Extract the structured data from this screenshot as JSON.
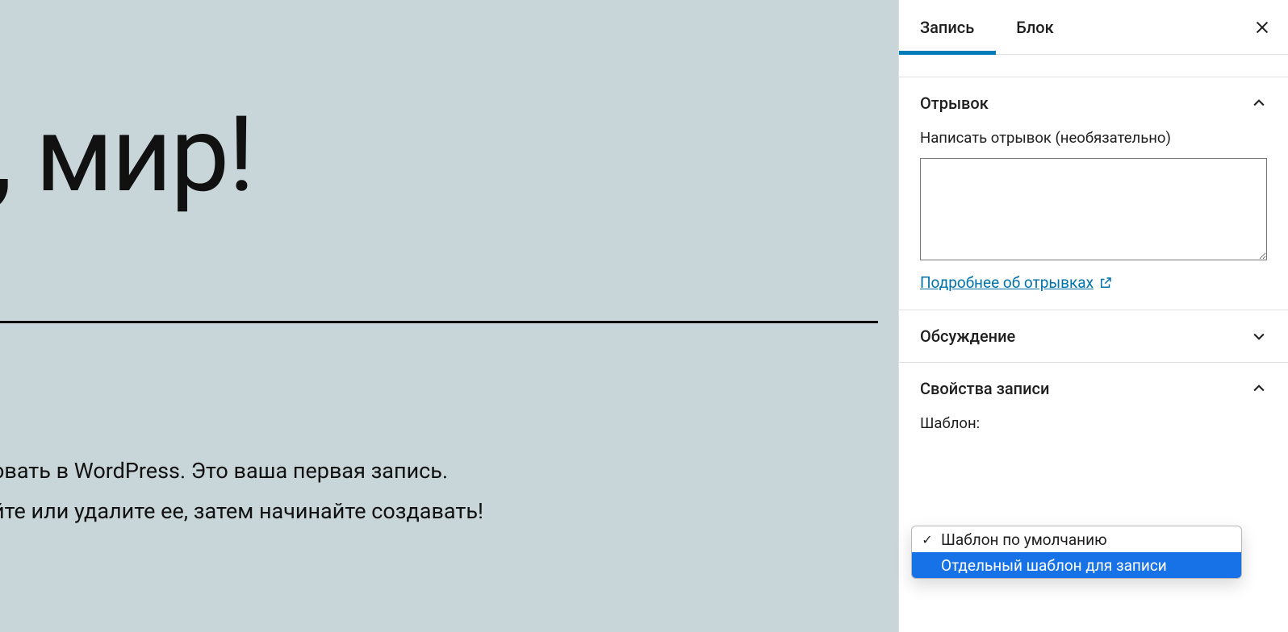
{
  "canvas": {
    "title": ", мир!",
    "paragraph_line1": "овать в WordPress. Это ваша первая запись.",
    "paragraph_line2": "йте или удалите ее, затем начинайте создавать!"
  },
  "sidebar": {
    "tabs": {
      "post": "Запись",
      "block": "Блок"
    },
    "excerpt": {
      "title": "Отрывок",
      "label": "Написать отрывок (необязательно)",
      "value": "",
      "link": "Подробнее об отрывках"
    },
    "discussion": {
      "title": "Обсуждение"
    },
    "attributes": {
      "title": "Свойства записи",
      "template_label": "Шаблон:"
    }
  },
  "dropdown": {
    "options": [
      {
        "label": "Шаблон по умолчанию",
        "selected": true
      },
      {
        "label": "Отдельный шаблон для записи",
        "selected": false,
        "highlight": true
      }
    ]
  }
}
